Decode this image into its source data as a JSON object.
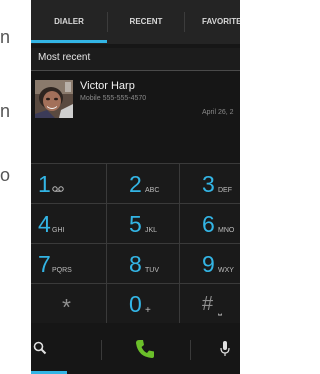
{
  "side_text": [
    "n",
    "n",
    "o"
  ],
  "tabs": [
    {
      "label": "DIALER",
      "selected": true
    },
    {
      "label": "RECENT",
      "selected": false
    },
    {
      "label": "FAVORITES",
      "selected": false
    }
  ],
  "recent": {
    "header": "Most recent",
    "name": "Victor Harp",
    "detail": "Mobile 555-555-4570",
    "date": "April 26, 2"
  },
  "dialpad": {
    "keys": [
      {
        "digit": "1",
        "letters": "QO"
      },
      {
        "digit": "2",
        "letters": "ABC"
      },
      {
        "digit": "3",
        "letters": "DEF"
      },
      {
        "digit": "4",
        "letters": "GHI"
      },
      {
        "digit": "5",
        "letters": "JKL"
      },
      {
        "digit": "6",
        "letters": "MNO"
      },
      {
        "digit": "7",
        "letters": "PQRS"
      },
      {
        "digit": "8",
        "letters": "TUV"
      },
      {
        "digit": "9",
        "letters": "WXY"
      },
      {
        "digit": "*",
        "letters": ""
      },
      {
        "digit": "0",
        "letters": "+"
      },
      {
        "digit": "#",
        "letters": "⎵"
      }
    ]
  },
  "icons": {
    "search": "search-icon",
    "call": "phone-call-icon",
    "voicemail": "voicemail-icon",
    "mic": "microphone-icon"
  },
  "colors": {
    "accent": "#33b5e5",
    "call_green": "#6bbf2a",
    "background": "#161616"
  }
}
